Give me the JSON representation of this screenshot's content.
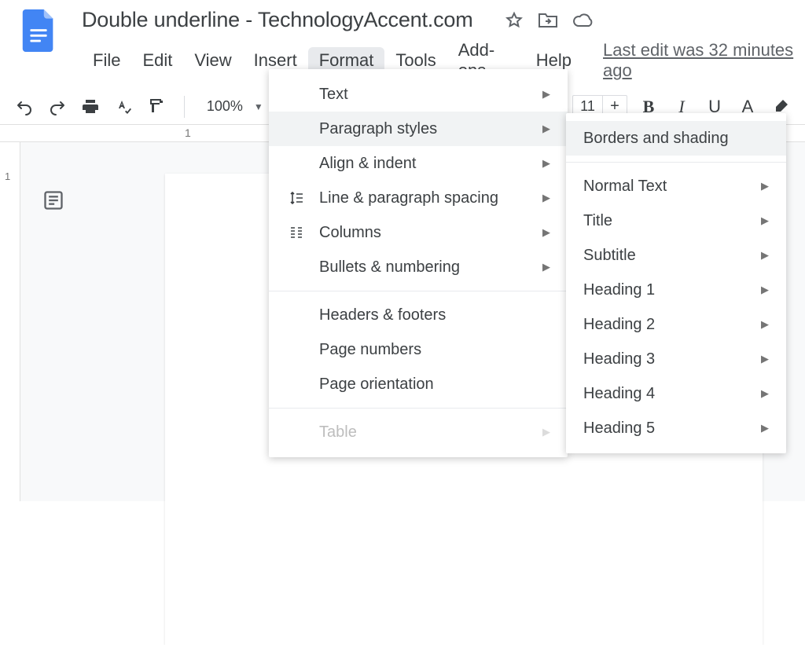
{
  "header": {
    "title": "Double underline - TechnologyAccent.com",
    "last_edit": "Last edit was 32 minutes ago"
  },
  "menubar": {
    "items": [
      "File",
      "Edit",
      "View",
      "Insert",
      "Format",
      "Tools",
      "Add-ons",
      "Help"
    ],
    "active_index": 4
  },
  "toolbar": {
    "zoom": "100%",
    "font_size": "11",
    "bold_label": "B",
    "italic_label": "I",
    "underline_label": "U",
    "text_color_label": "A"
  },
  "ruler": {
    "mark1": "1",
    "vmark1": "1"
  },
  "format_menu": [
    {
      "label": "Text",
      "icon": "",
      "submenu": true
    },
    {
      "label": "Paragraph styles",
      "icon": "",
      "submenu": true,
      "hover": true
    },
    {
      "label": "Align & indent",
      "icon": "",
      "submenu": true
    },
    {
      "label": "Line & paragraph spacing",
      "icon": "linespace",
      "submenu": true
    },
    {
      "label": "Columns",
      "icon": "columns",
      "submenu": true
    },
    {
      "label": "Bullets & numbering",
      "icon": "",
      "submenu": true
    },
    {
      "sep": true
    },
    {
      "label": "Headers & footers",
      "icon": "",
      "submenu": false
    },
    {
      "label": "Page numbers",
      "icon": "",
      "submenu": false
    },
    {
      "label": "Page orientation",
      "icon": "",
      "submenu": false
    },
    {
      "sep": true
    },
    {
      "label": "Table",
      "icon": "",
      "submenu": true,
      "disabled": true
    }
  ],
  "paragraph_menu": [
    {
      "label": "Borders and shading",
      "submenu": false,
      "hover": true
    },
    {
      "sep": true
    },
    {
      "label": "Normal Text",
      "submenu": true
    },
    {
      "label": "Title",
      "submenu": true
    },
    {
      "label": "Subtitle",
      "submenu": true
    },
    {
      "label": "Heading 1",
      "submenu": true
    },
    {
      "label": "Heading 2",
      "submenu": true
    },
    {
      "label": "Heading 3",
      "submenu": true
    },
    {
      "label": "Heading 4",
      "submenu": true
    },
    {
      "label": "Heading 5",
      "submenu": true
    }
  ]
}
